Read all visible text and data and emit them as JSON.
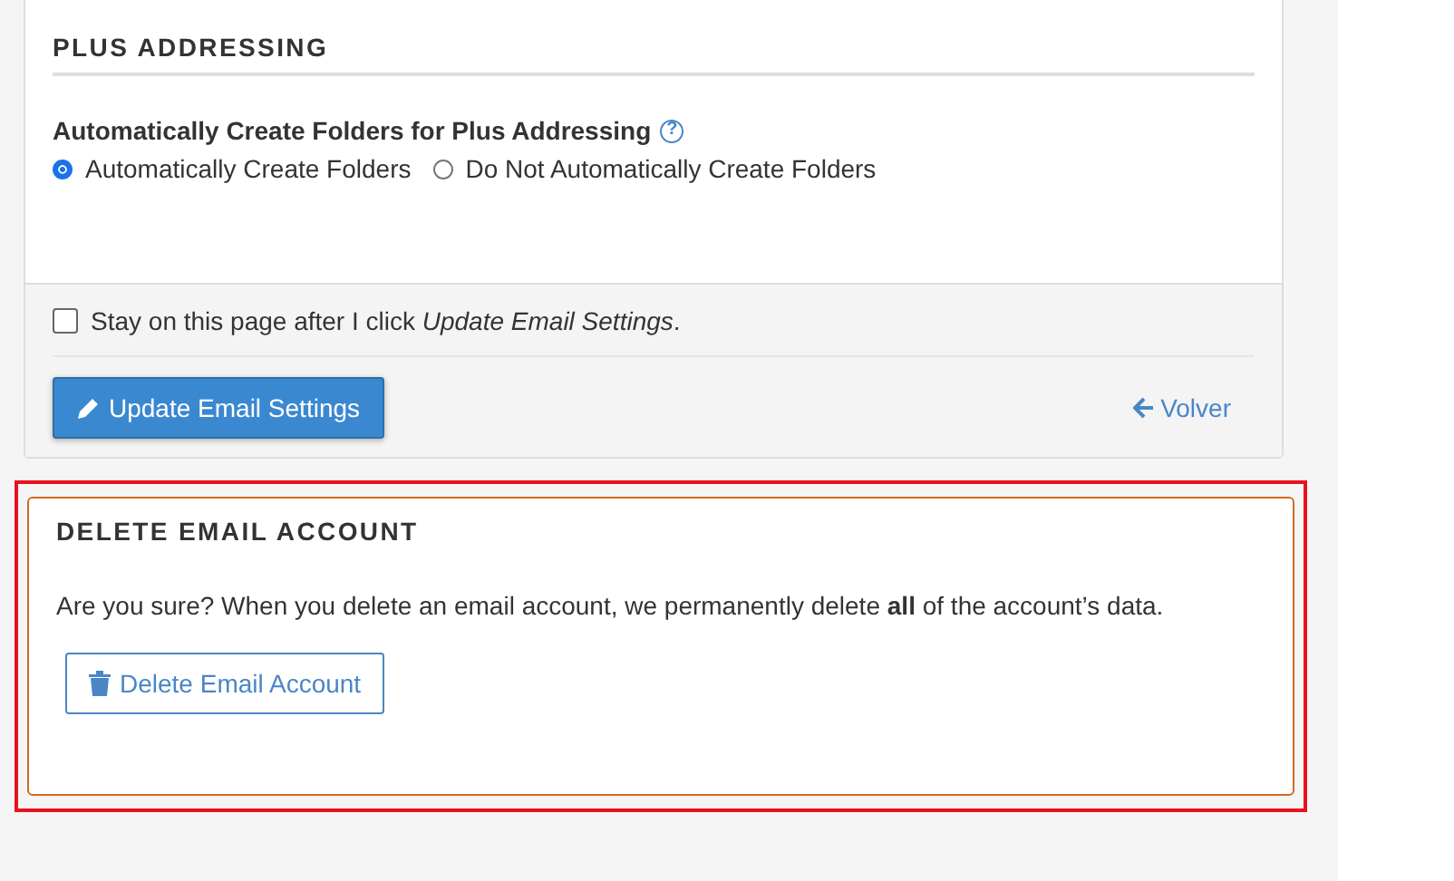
{
  "settings_card": {
    "section_title": "PLUS ADDRESSING",
    "field_label": "Automatically Create Folders for Plus Addressing",
    "help_icon": "?",
    "options": [
      {
        "label": "Automatically Create Folders",
        "selected": true
      },
      {
        "label": "Do Not Automatically Create Folders",
        "selected": false
      }
    ],
    "stay_checkbox": {
      "label": "Stay on this page after I click *Update Email Settings*.",
      "checked": false
    },
    "update_button": "Update Email Settings",
    "back_link": "Volver"
  },
  "delete_card": {
    "title": "DELETE EMAIL ACCOUNT",
    "message": "Are you sure? When you delete an email account, we permanently delete **all** of the account’s data.",
    "delete_button": "Delete Email Account",
    "highlighted": true
  }
}
